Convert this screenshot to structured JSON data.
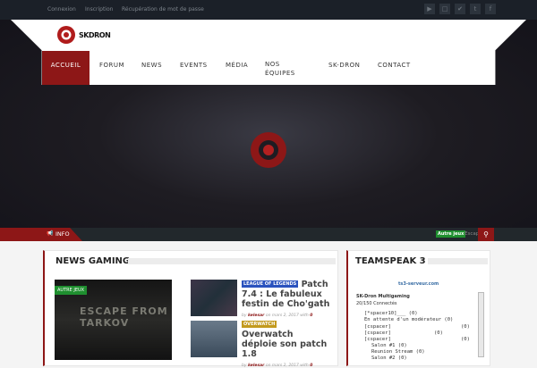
{
  "topbar": {
    "links": [
      "Connexion",
      "Inscription",
      "Récupération de mot de passe"
    ],
    "social_icons": [
      "youtube-icon",
      "twitch-icon",
      "steam-icon",
      "twitter-icon",
      "facebook-icon"
    ]
  },
  "brand": {
    "name": "SKDRON",
    "accent": "#8d1717"
  },
  "nav": [
    "ACCUEIL",
    "FORUM",
    "NEWS",
    "EVENTS",
    "MÉDIA",
    "NOS ÉQUIPES",
    "SK-DRON",
    "CONTACT"
  ],
  "ticker": {
    "label": "INFO",
    "tag": "Autre jeux",
    "text": "Escap"
  },
  "news": {
    "heading": "NEWS GAMING",
    "featured": {
      "tag": "AUTRE JEUX",
      "image_text": "ESCAPE FROM TARKOV"
    },
    "items": [
      {
        "tag": "LEAGUE OF LEGENDS",
        "title": "Patch 7.4 : Le fabuleux festin de Cho'gath",
        "by": "by",
        "author": "kelesar",
        "date": "on mars 2, 2017 with",
        "comments": "0"
      },
      {
        "tag": "OVERWATCH",
        "title": "Overwatch déploie son patch 1.8",
        "by": "by",
        "author": "kelesar",
        "date": "on mars 2, 2017 with",
        "comments": "0"
      }
    ]
  },
  "teamspeak": {
    "heading": "TEAMSPEAK 3",
    "provider": "ts3-serveur.com",
    "server": "SK-Dron Multigaming",
    "connected": "20/150 Connectés",
    "channels": [
      "[*spacer10]___ (0)",
      "En attente d'un modérateur (0)",
      "[cspacer]",
      "[cspacer]",
      "[cspacer]",
      "Salon #1 (0)",
      "Reunion Stream (0)",
      "Salon #2 (0)"
    ],
    "counts": [
      "(0)",
      "(0)",
      "(0)"
    ]
  }
}
